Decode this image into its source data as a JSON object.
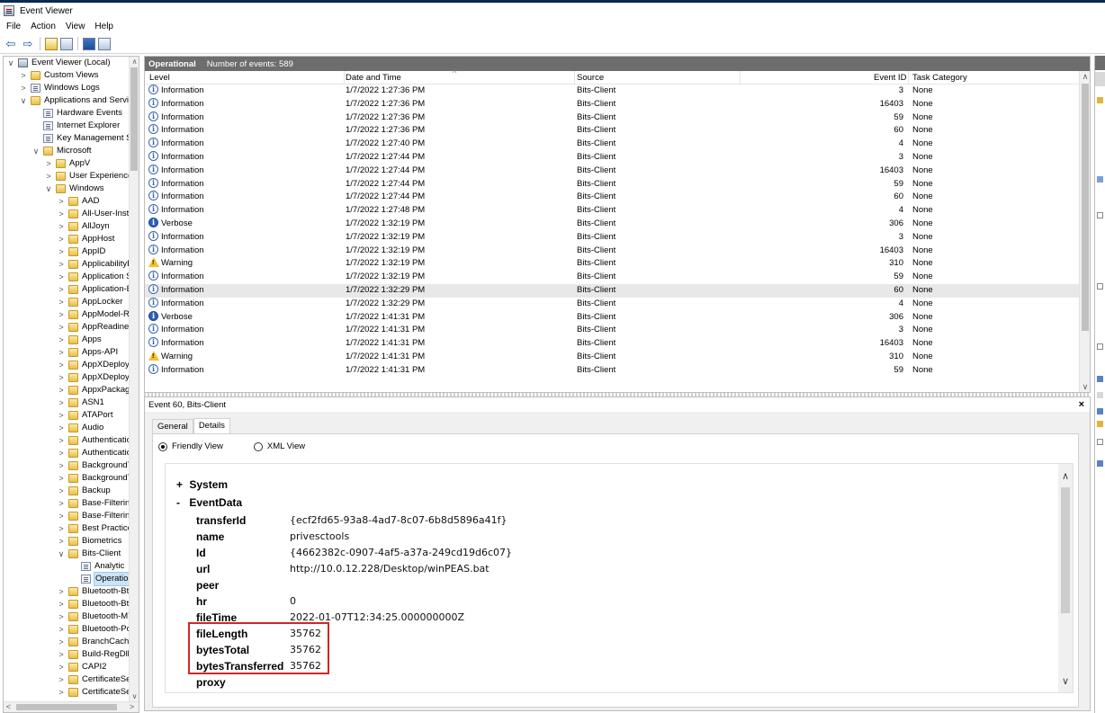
{
  "window": {
    "title": "Event Viewer"
  },
  "menu": [
    "File",
    "Action",
    "View",
    "Help"
  ],
  "toolbar": {
    "back_glyph": "⇦",
    "forward_glyph": "⇨"
  },
  "tree": {
    "items": [
      {
        "label": "Event Viewer (Local)",
        "chev": "∨",
        "indent": 0,
        "icon": "root"
      },
      {
        "label": "Custom Views",
        "chev": ">",
        "indent": 1,
        "icon": "folder"
      },
      {
        "label": "Windows Logs",
        "chev": ">",
        "indent": 1,
        "icon": "log"
      },
      {
        "label": "Applications and Services",
        "chev": "∨",
        "indent": 1,
        "icon": "folder"
      },
      {
        "label": "Hardware Events",
        "chev": "",
        "indent": 2,
        "icon": "log"
      },
      {
        "label": "Internet Explorer",
        "chev": "",
        "indent": 2,
        "icon": "log"
      },
      {
        "label": "Key Management Ser",
        "chev": "",
        "indent": 2,
        "icon": "log"
      },
      {
        "label": "Microsoft",
        "chev": "∨",
        "indent": 2,
        "icon": "folder"
      },
      {
        "label": "AppV",
        "chev": ">",
        "indent": 3,
        "icon": "folder"
      },
      {
        "label": "User Experience Vi",
        "chev": ">",
        "indent": 3,
        "icon": "folder"
      },
      {
        "label": "Windows",
        "chev": "∨",
        "indent": 3,
        "icon": "folder"
      },
      {
        "label": "AAD",
        "chev": ">",
        "indent": 4,
        "icon": "folder"
      },
      {
        "label": "All-User-Instal",
        "chev": ">",
        "indent": 4,
        "icon": "folder"
      },
      {
        "label": "AllJoyn",
        "chev": ">",
        "indent": 4,
        "icon": "folder"
      },
      {
        "label": "AppHost",
        "chev": ">",
        "indent": 4,
        "icon": "folder"
      },
      {
        "label": "AppID",
        "chev": ">",
        "indent": 4,
        "icon": "folder"
      },
      {
        "label": "ApplicabilityEr",
        "chev": ">",
        "indent": 4,
        "icon": "folder"
      },
      {
        "label": "Application Se",
        "chev": ">",
        "indent": 4,
        "icon": "folder"
      },
      {
        "label": "Application-Ex",
        "chev": ">",
        "indent": 4,
        "icon": "folder"
      },
      {
        "label": "AppLocker",
        "chev": ">",
        "indent": 4,
        "icon": "folder"
      },
      {
        "label": "AppModel-Ru",
        "chev": ">",
        "indent": 4,
        "icon": "folder"
      },
      {
        "label": "AppReadiness",
        "chev": ">",
        "indent": 4,
        "icon": "folder"
      },
      {
        "label": "Apps",
        "chev": ">",
        "indent": 4,
        "icon": "folder"
      },
      {
        "label": "Apps-API",
        "chev": ">",
        "indent": 4,
        "icon": "folder"
      },
      {
        "label": "AppXDeploym",
        "chev": ">",
        "indent": 4,
        "icon": "folder"
      },
      {
        "label": "AppXDeploym",
        "chev": ">",
        "indent": 4,
        "icon": "folder"
      },
      {
        "label": "AppxPackagin",
        "chev": ">",
        "indent": 4,
        "icon": "folder"
      },
      {
        "label": "ASN1",
        "chev": ">",
        "indent": 4,
        "icon": "folder"
      },
      {
        "label": "ATAPort",
        "chev": ">",
        "indent": 4,
        "icon": "folder"
      },
      {
        "label": "Audio",
        "chev": ">",
        "indent": 4,
        "icon": "folder"
      },
      {
        "label": "Authenticatior",
        "chev": ">",
        "indent": 4,
        "icon": "folder"
      },
      {
        "label": "Authenticatior",
        "chev": ">",
        "indent": 4,
        "icon": "folder"
      },
      {
        "label": "BackgroundTa",
        "chev": ">",
        "indent": 4,
        "icon": "folder"
      },
      {
        "label": "BackgroundTr",
        "chev": ">",
        "indent": 4,
        "icon": "folder"
      },
      {
        "label": "Backup",
        "chev": ">",
        "indent": 4,
        "icon": "folder"
      },
      {
        "label": "Base-Filtering-",
        "chev": ">",
        "indent": 4,
        "icon": "folder"
      },
      {
        "label": "Base-Filtering-",
        "chev": ">",
        "indent": 4,
        "icon": "folder"
      },
      {
        "label": "Best Practices",
        "chev": ">",
        "indent": 4,
        "icon": "folder"
      },
      {
        "label": "Biometrics",
        "chev": ">",
        "indent": 4,
        "icon": "folder"
      },
      {
        "label": "Bits-Client",
        "chev": "∨",
        "indent": 4,
        "icon": "folder"
      },
      {
        "label": "Analytic",
        "chev": "",
        "indent": 5,
        "icon": "log"
      },
      {
        "label": "Operationa",
        "chev": "",
        "indent": 5,
        "icon": "log",
        "selected": true
      },
      {
        "label": "Bluetooth-Bth",
        "chev": ">",
        "indent": 4,
        "icon": "folder"
      },
      {
        "label": "Bluetooth-Bth",
        "chev": ">",
        "indent": 4,
        "icon": "folder"
      },
      {
        "label": "Bluetooth-MT",
        "chev": ">",
        "indent": 4,
        "icon": "folder"
      },
      {
        "label": "Bluetooth-Poli",
        "chev": ">",
        "indent": 4,
        "icon": "folder"
      },
      {
        "label": "BranchCacheS",
        "chev": ">",
        "indent": 4,
        "icon": "folder"
      },
      {
        "label": "Build-RegDll",
        "chev": ">",
        "indent": 4,
        "icon": "folder"
      },
      {
        "label": "CAPI2",
        "chev": ">",
        "indent": 4,
        "icon": "folder"
      },
      {
        "label": "CertificateServ",
        "chev": ">",
        "indent": 4,
        "icon": "folder"
      },
      {
        "label": "CertificateServ",
        "chev": ">",
        "indent": 4,
        "icon": "folder"
      }
    ]
  },
  "list": {
    "log_name": "Operational",
    "count_text": "Number of events: 589",
    "columns": [
      "Level",
      "Date and Time",
      "Source",
      "Event ID",
      "Task Category"
    ],
    "rows": [
      {
        "level": "Information",
        "date": "1/7/2022 1:27:36 PM",
        "source": "Bits-Client",
        "event_id": "3",
        "task": "None"
      },
      {
        "level": "Information",
        "date": "1/7/2022 1:27:36 PM",
        "source": "Bits-Client",
        "event_id": "16403",
        "task": "None"
      },
      {
        "level": "Information",
        "date": "1/7/2022 1:27:36 PM",
        "source": "Bits-Client",
        "event_id": "59",
        "task": "None"
      },
      {
        "level": "Information",
        "date": "1/7/2022 1:27:36 PM",
        "source": "Bits-Client",
        "event_id": "60",
        "task": "None"
      },
      {
        "level": "Information",
        "date": "1/7/2022 1:27:40 PM",
        "source": "Bits-Client",
        "event_id": "4",
        "task": "None"
      },
      {
        "level": "Information",
        "date": "1/7/2022 1:27:44 PM",
        "source": "Bits-Client",
        "event_id": "3",
        "task": "None"
      },
      {
        "level": "Information",
        "date": "1/7/2022 1:27:44 PM",
        "source": "Bits-Client",
        "event_id": "16403",
        "task": "None"
      },
      {
        "level": "Information",
        "date": "1/7/2022 1:27:44 PM",
        "source": "Bits-Client",
        "event_id": "59",
        "task": "None"
      },
      {
        "level": "Information",
        "date": "1/7/2022 1:27:44 PM",
        "source": "Bits-Client",
        "event_id": "60",
        "task": "None"
      },
      {
        "level": "Information",
        "date": "1/7/2022 1:27:48 PM",
        "source": "Bits-Client",
        "event_id": "4",
        "task": "None"
      },
      {
        "level": "Verbose",
        "date": "1/7/2022 1:32:19 PM",
        "source": "Bits-Client",
        "event_id": "306",
        "task": "None"
      },
      {
        "level": "Information",
        "date": "1/7/2022 1:32:19 PM",
        "source": "Bits-Client",
        "event_id": "3",
        "task": "None"
      },
      {
        "level": "Information",
        "date": "1/7/2022 1:32:19 PM",
        "source": "Bits-Client",
        "event_id": "16403",
        "task": "None"
      },
      {
        "level": "Warning",
        "date": "1/7/2022 1:32:19 PM",
        "source": "Bits-Client",
        "event_id": "310",
        "task": "None"
      },
      {
        "level": "Information",
        "date": "1/7/2022 1:32:19 PM",
        "source": "Bits-Client",
        "event_id": "59",
        "task": "None"
      },
      {
        "level": "Information",
        "date": "1/7/2022 1:32:29 PM",
        "source": "Bits-Client",
        "event_id": "60",
        "task": "None",
        "selected": true
      },
      {
        "level": "Information",
        "date": "1/7/2022 1:32:29 PM",
        "source": "Bits-Client",
        "event_id": "4",
        "task": "None"
      },
      {
        "level": "Verbose",
        "date": "1/7/2022 1:41:31 PM",
        "source": "Bits-Client",
        "event_id": "306",
        "task": "None"
      },
      {
        "level": "Information",
        "date": "1/7/2022 1:41:31 PM",
        "source": "Bits-Client",
        "event_id": "3",
        "task": "None"
      },
      {
        "level": "Information",
        "date": "1/7/2022 1:41:31 PM",
        "source": "Bits-Client",
        "event_id": "16403",
        "task": "None"
      },
      {
        "level": "Warning",
        "date": "1/7/2022 1:41:31 PM",
        "source": "Bits-Client",
        "event_id": "310",
        "task": "None"
      },
      {
        "level": "Information",
        "date": "1/7/2022 1:41:31 PM",
        "source": "Bits-Client",
        "event_id": "59",
        "task": "None"
      }
    ]
  },
  "detail": {
    "title": "Event 60, Bits-Client",
    "close_glyph": "×",
    "tabs": [
      "General",
      "Details"
    ],
    "active_tab": "Details",
    "views": [
      "Friendly View",
      "XML View"
    ],
    "selected_view": "Friendly View",
    "system_label": "System",
    "eventdata_label": "EventData",
    "expand_glyph": "+",
    "collapse_glyph": "-",
    "fields": [
      {
        "key": "transferId",
        "value": "{ecf2fd65-93a8-4ad7-8c07-6b8d5896a41f}"
      },
      {
        "key": "name",
        "value": "privesctools"
      },
      {
        "key": "Id",
        "value": "{4662382c-0907-4af5-a37a-249cd19d6c07}"
      },
      {
        "key": "url",
        "value": "http://10.0.12.228/Desktop/winPEAS.bat"
      },
      {
        "key": "peer",
        "value": ""
      },
      {
        "key": "hr",
        "value": "0"
      },
      {
        "key": "fileTime",
        "value": "2022-01-07T12:34:25.000000000Z"
      },
      {
        "key": "fileLength",
        "value": "35762"
      },
      {
        "key": "bytesTotal",
        "value": "35762"
      },
      {
        "key": "bytesTransferred",
        "value": "35762"
      },
      {
        "key": "proxy",
        "value": ""
      }
    ]
  },
  "colors": {
    "header_bg": "#6d6d6d",
    "selection_bg": "#e8e8e8",
    "highlight_border": "#d1262b"
  }
}
